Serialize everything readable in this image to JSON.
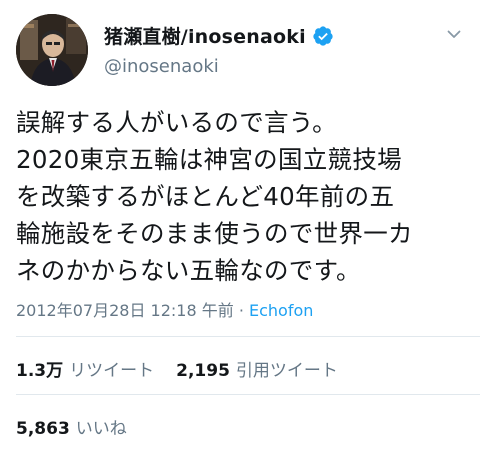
{
  "author": {
    "display_name": "猪瀬直樹/inosenaoki",
    "handle": "@inosenaoki",
    "verified": true
  },
  "tweet": {
    "text": "誤解する人がいるので言う。\n2020東京五輪は神宮の国立競技場\nを改築するがほとんど40年前の五\n輪施設をそのまま使うので世界一カ\nネのかからない五輪なのです。"
  },
  "meta": {
    "timestamp": "2012年07月28日 12:18 午前",
    "separator": " · ",
    "source": "Echofon"
  },
  "stats": {
    "retweets_count": "1.3万",
    "retweets_label": "リツイート",
    "quotes_count": "2,195",
    "quotes_label": "引用ツイート",
    "likes_count": "5,863",
    "likes_label": "いいね"
  },
  "colors": {
    "verified": "#1da1f2",
    "link": "#1da1f2",
    "secondary_text": "#657786"
  },
  "icons": {
    "verified": "verified-badge-icon",
    "menu": "chevron-down-icon"
  }
}
